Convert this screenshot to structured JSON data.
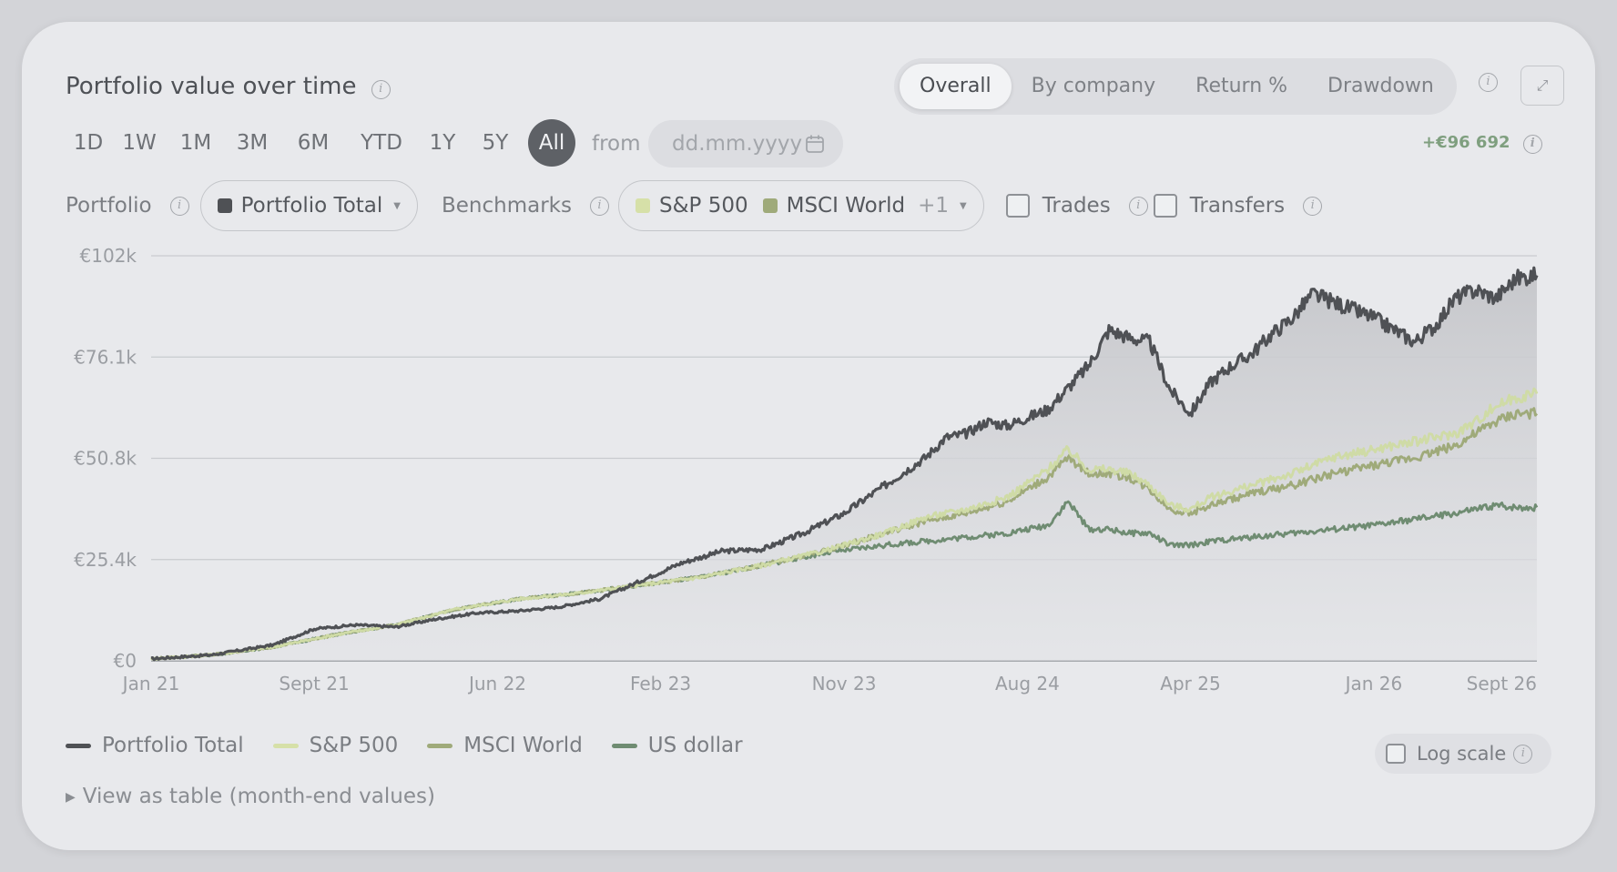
{
  "header": {
    "title": "Portfolio value over time",
    "tabs": [
      {
        "label": "Overall",
        "active": true
      },
      {
        "label": "By company",
        "active": false
      },
      {
        "label": "Return %",
        "active": false
      },
      {
        "label": "Drawdown",
        "active": false
      }
    ],
    "expand_icon": "expand-icon"
  },
  "ranges": {
    "items": [
      "1D",
      "1W",
      "1M",
      "3M",
      "6M",
      "YTD",
      "1Y",
      "5Y",
      "All"
    ],
    "active": "All",
    "from_label": "from",
    "date_placeholder": "dd.mm.yyyy"
  },
  "gain": "+€96 692",
  "filters": {
    "portfolio_label": "Portfolio",
    "portfolio_value": "Portfolio Total",
    "benchmarks_label": "Benchmarks",
    "benchmark_1": "S&P 500",
    "benchmark_2": "MSCI World",
    "benchmark_more": "+1",
    "trades_label": "Trades",
    "transfers_label": "Transfers"
  },
  "log_scale_label": "Log scale",
  "view_table_label": "View as table (month-end values)",
  "colors": {
    "portfolio": "#4f5155",
    "sp500": "#cfdba6",
    "msci": "#9faa7a",
    "usd": "#6f8c72",
    "gain": "#7f9f7f"
  },
  "chart_data": {
    "type": "line",
    "y_ticks": [
      "€0",
      "€25.4k",
      "€50.8k",
      "€76.1k",
      "€102k"
    ],
    "ylim": [
      0,
      101600
    ],
    "x_ticks": [
      "Jan 21",
      "Sept 21",
      "Jun 22",
      "Feb 23",
      "Nov 23",
      "Aug 24",
      "Apr 25",
      "Jan 26",
      "Sept 26"
    ],
    "x_tick_months": [
      0,
      8,
      17,
      25,
      34,
      43,
      51,
      60,
      68
    ],
    "x_month_range": [
      0,
      68
    ],
    "grid": true,
    "series": [
      {
        "name": "Portfolio Total",
        "color": "#4f5155",
        "months": [
          0,
          3,
          6,
          8,
          10,
          12,
          14,
          16,
          18,
          20,
          22,
          24,
          26,
          28,
          30,
          32,
          34,
          36,
          38,
          39,
          40,
          41,
          42,
          44,
          46,
          47,
          48,
          49,
          50,
          51,
          52,
          53,
          54,
          55,
          56,
          57,
          58,
          60,
          62,
          63,
          64,
          65,
          66,
          67,
          68
        ],
        "values": [
          500,
          1500,
          4000,
          8000,
          9000,
          8500,
          10500,
          12000,
          12500,
          13500,
          15500,
          20000,
          24500,
          27500,
          28000,
          32000,
          37000,
          44000,
          51000,
          56000,
          57000,
          60000,
          59000,
          63000,
          74000,
          83000,
          81000,
          80000,
          68000,
          62000,
          70000,
          74000,
          77000,
          82000,
          86000,
          92000,
          90000,
          86000,
          80000,
          84000,
          91000,
          93000,
          91000,
          96000,
          96692
        ]
      },
      {
        "name": "S&P 500",
        "color": "#cfdba6",
        "months": [
          0,
          3,
          6,
          9,
          12,
          15,
          18,
          21,
          24,
          27,
          30,
          33,
          36,
          38,
          40,
          42,
          44,
          45,
          46,
          47,
          48,
          49,
          50,
          51,
          52,
          54,
          56,
          58,
          60,
          62,
          64,
          65,
          66,
          67,
          68
        ],
        "values": [
          500,
          1500,
          3500,
          6500,
          9000,
          13000,
          15500,
          17000,
          19000,
          21000,
          24000,
          27500,
          32000,
          36000,
          38000,
          41000,
          48000,
          53000,
          48000,
          48000,
          47000,
          44000,
          39000,
          38000,
          41000,
          44000,
          47000,
          51000,
          53000,
          55000,
          57000,
          60000,
          64000,
          66000,
          67000
        ]
      },
      {
        "name": "MSCI World",
        "color": "#9faa7a",
        "months": [
          0,
          3,
          6,
          9,
          12,
          15,
          18,
          21,
          24,
          27,
          30,
          33,
          36,
          38,
          40,
          42,
          44,
          45,
          46,
          47,
          48,
          49,
          50,
          51,
          52,
          54,
          56,
          58,
          60,
          62,
          64,
          65,
          66,
          67,
          68
        ],
        "values": [
          500,
          1500,
          3500,
          6500,
          9000,
          13000,
          15500,
          17000,
          19000,
          21000,
          24000,
          27500,
          32000,
          35000,
          37000,
          40000,
          46000,
          51000,
          47000,
          47000,
          46000,
          43000,
          38000,
          37000,
          39000,
          42000,
          44000,
          47000,
          49000,
          51000,
          54000,
          57000,
          60000,
          62000,
          62000
        ]
      },
      {
        "name": "US dollar",
        "color": "#6f8c72",
        "months": [
          0,
          3,
          6,
          9,
          12,
          15,
          18,
          21,
          24,
          27,
          30,
          33,
          36,
          38,
          40,
          42,
          44,
          45,
          46,
          47,
          48,
          49,
          50,
          51,
          52,
          54,
          56,
          58,
          60,
          62,
          64,
          65,
          66,
          67,
          68
        ],
        "values": [
          500,
          1500,
          3500,
          6500,
          9000,
          13000,
          15500,
          17000,
          19000,
          21000,
          24000,
          27000,
          29000,
          30000,
          31000,
          32000,
          34000,
          40000,
          33000,
          33000,
          32000,
          32000,
          29000,
          29000,
          30000,
          31000,
          32000,
          33000,
          34000,
          35500,
          37000,
          38000,
          39000,
          38500,
          38500
        ]
      }
    ]
  }
}
